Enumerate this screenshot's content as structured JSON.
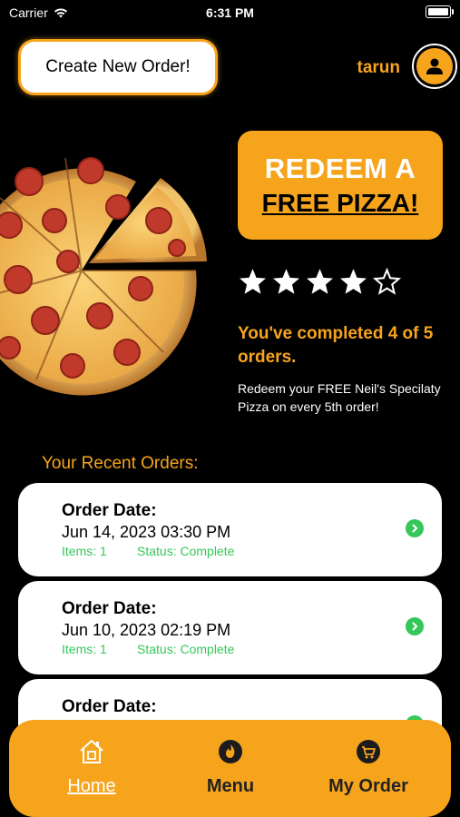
{
  "status_bar": {
    "carrier": "Carrier",
    "time": "6:31 PM"
  },
  "header": {
    "create_order_label": "Create New Order!",
    "username": "tarun"
  },
  "rewards": {
    "redeem_line1": "REDEEM A",
    "redeem_line2": "FREE PIZZA!",
    "stars_filled": 4,
    "stars_total": 5,
    "completed_text": "You've completed 4 of 5 orders.",
    "description": "Redeem your FREE Neil's Specilaty Pizza on every 5th order!"
  },
  "recent_orders": {
    "title": "Your Recent Orders:",
    "orders": [
      {
        "label": "Order Date:",
        "date": "Jun 14, 2023 03:30 PM",
        "items": "Items: 1",
        "status": "Status: Complete"
      },
      {
        "label": "Order Date:",
        "date": "Jun 10, 2023 02:19 PM",
        "items": "Items: 1",
        "status": "Status: Complete"
      },
      {
        "label": "Order Date:"
      }
    ]
  },
  "tabbar": {
    "tabs": [
      {
        "label": "Home",
        "icon": "house-icon"
      },
      {
        "label": "Menu",
        "icon": "flame-icon"
      },
      {
        "label": "My Order",
        "icon": "cart-icon"
      }
    ]
  },
  "colors": {
    "accent": "#f7a41d",
    "success": "#35c759",
    "background": "#000000"
  }
}
